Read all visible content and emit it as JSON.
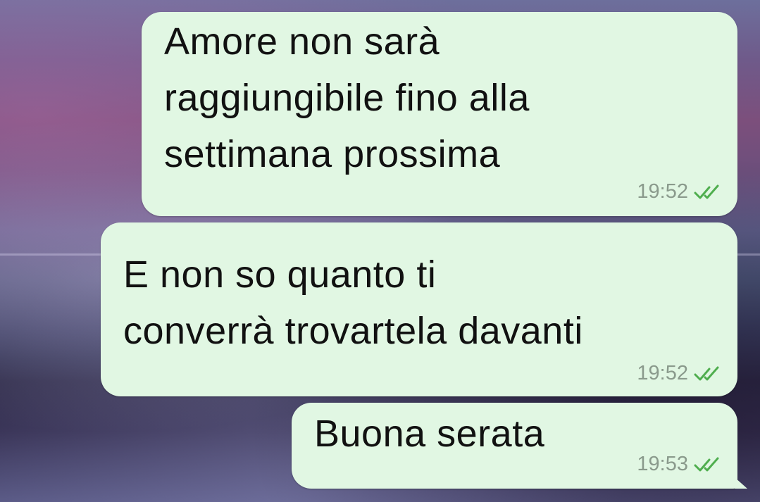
{
  "chat": {
    "messages": [
      {
        "text": "Amore non sarà\nraggiungibile fino alla\nsettimana prossima",
        "time": "19:52",
        "status_icon": "double-check-icon"
      },
      {
        "text": "E non so quanto ti\nconverrà trovartela davanti",
        "time": "19:52",
        "status_icon": "double-check-icon"
      },
      {
        "text": "Buona serata",
        "time": "19:53",
        "status_icon": "double-check-icon"
      }
    ]
  },
  "colors": {
    "bubble_background": "#e1f7e3",
    "timestamp": "#8a9a8c",
    "read_tick": "#4fae4e",
    "message_text": "#111111"
  }
}
